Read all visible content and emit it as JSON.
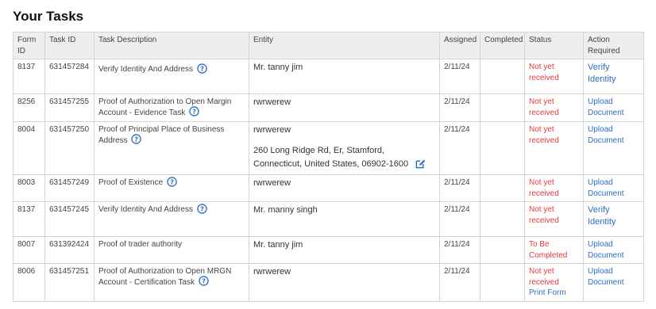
{
  "page": {
    "title": "Your Tasks"
  },
  "colors": {
    "status_red": "#e03a3a",
    "link_blue": "#2a6fc4",
    "header_bg": "#eceef0"
  },
  "table": {
    "headers": {
      "form_id": "Form ID",
      "task_id": "Task ID",
      "description": "Task Description",
      "entity": "Entity",
      "assigned": "Assigned",
      "completed": "Completed",
      "status": "Status",
      "action": "Action Required"
    },
    "rows": [
      {
        "form_id": "8137",
        "task_id": "631457284",
        "description": "Verify Identity And Address",
        "entity": "Mr. tanny jim",
        "address_line1": "",
        "address_line2": "",
        "assigned": "2/11/24",
        "completed": "",
        "status": "Not yet received",
        "status_extra": "",
        "action": "Verify Identity",
        "help_icon": "question-circle-icon"
      },
      {
        "form_id": "8256",
        "task_id": "631457255",
        "description": "Proof of Authorization to Open Margin Account - Evidence Task",
        "entity": "rwrwerew",
        "address_line1": "",
        "address_line2": "",
        "assigned": "2/11/24",
        "completed": "",
        "status": "Not yet received",
        "status_extra": "",
        "action": "Upload Document",
        "help_icon": "question-circle-icon"
      },
      {
        "form_id": "8004",
        "task_id": "631457250",
        "description": "Proof of Principal Place of Business Address",
        "entity": "rwrwerew",
        "address_line1": "260 Long Ridge Rd, Er, Stamford,",
        "address_line2": "Connecticut, United States, 06902-1600",
        "assigned": "2/11/24",
        "completed": "",
        "status": "Not yet received",
        "status_extra": "",
        "action": "Upload Document",
        "help_icon": "question-circle-icon",
        "edit_icon": "edit-icon"
      },
      {
        "form_id": "8003",
        "task_id": "631457249",
        "description": "Proof of Existence",
        "entity": "rwrwerew",
        "address_line1": "",
        "address_line2": "",
        "assigned": "2/11/24",
        "completed": "",
        "status": "Not yet received",
        "status_extra": "",
        "action": "Upload Document",
        "help_icon": "question-circle-icon"
      },
      {
        "form_id": "8137",
        "task_id": "631457245",
        "description": "Verify Identity And Address",
        "entity": "Mr. manny singh",
        "address_line1": "",
        "address_line2": "",
        "assigned": "2/11/24",
        "completed": "",
        "status": "Not yet received",
        "status_extra": "",
        "action": "Verify Identity",
        "help_icon": "question-circle-icon"
      },
      {
        "form_id": "8007",
        "task_id": "631392424",
        "description": "Proof of trader authority",
        "entity": "Mr. tanny jim",
        "address_line1": "",
        "address_line2": "",
        "assigned": "2/11/24",
        "completed": "",
        "status": "To Be Completed",
        "status_extra": "",
        "action": "Upload Document"
      },
      {
        "form_id": "8006",
        "task_id": "631457251",
        "description": "Proof of Authorization to Open MRGN Account - Certification Task",
        "entity": "rwrwerew",
        "address_line1": "",
        "address_line2": "",
        "assigned": "2/11/24",
        "completed": "",
        "status": "Not yet received",
        "status_extra": "Print Form",
        "action": "Upload Document",
        "help_icon": "question-circle-icon"
      }
    ]
  }
}
